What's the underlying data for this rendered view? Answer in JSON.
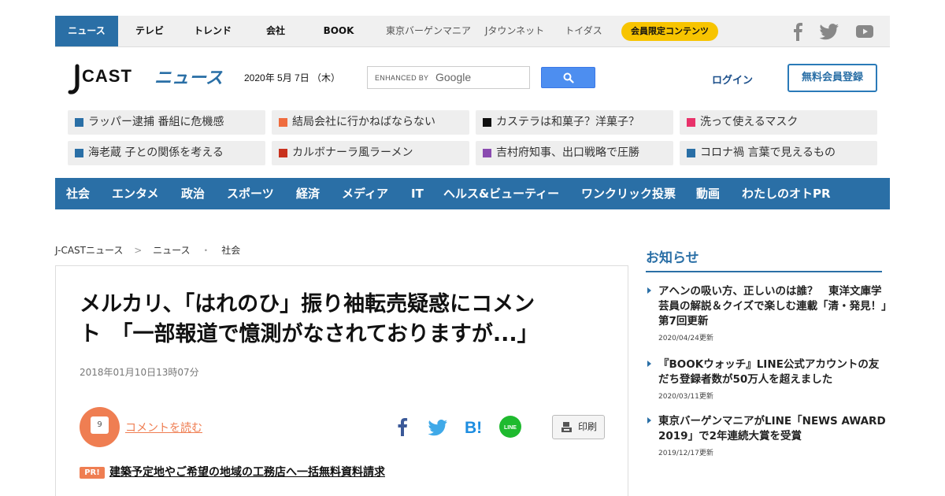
{
  "topnav": {
    "items": [
      "ニュース",
      "テレビ",
      "トレンド",
      "会社",
      "BOOK",
      "東京バーゲンマニア",
      "Jタウンネット",
      "トイダス"
    ],
    "member_badge": "会員限定コンテンツ"
  },
  "header": {
    "logo_text": "J-CAST ニュース",
    "date": "2020年 5月 7日 （木）",
    "search_enhanced": "ENHANCED BY",
    "search_google": "Google",
    "login": "ログイン",
    "register": "無料会員登録"
  },
  "tags": [
    {
      "label": "ラッパー逮捕 番組に危機感",
      "color": "#2a6fa6"
    },
    {
      "label": "結局会社に行かねばならない",
      "color": "#ef6c3e"
    },
    {
      "label": "カステラは和菓子？洋菓子？",
      "color": "#111111"
    },
    {
      "label": "洗って使えるマスク",
      "color": "#e8326a"
    },
    {
      "label": "海老蔵 子との関係を考える",
      "color": "#2a6fa6"
    },
    {
      "label": "カルボナーラ風ラーメン",
      "color": "#c8321e"
    },
    {
      "label": "吉村府知事、出口戦略で圧勝",
      "color": "#8a4bb0"
    },
    {
      "label": "コロナ禍 言葉で見えるもの",
      "color": "#2a6fa6"
    }
  ],
  "categories": [
    "社会",
    "エンタメ",
    "政治",
    "スポーツ",
    "経済",
    "メディア",
    "IT",
    "ヘルス&ビューティー",
    "ワンクリック投票",
    "動画",
    "わたしのオトPR"
  ],
  "breadcrumb": [
    "J-CASTニュース",
    ">",
    "ニュース",
    "・",
    "社会"
  ],
  "article": {
    "headline_line1": "メルカリ、「はれのひ」振り袖転売疑惑にコメン",
    "headline_line2": "ト　「一部報道で憶測がなされておりますが...」",
    "pubdate": "2018年01月10日13時07分",
    "comment_count": "9",
    "comment_link": "コメントを読む",
    "print_label": "印刷",
    "pr_badge": "PR!",
    "pr_link": "建築予定地やご希望の地域の工務店へ一括無料資料請求"
  },
  "sidebar": {
    "title": "お知らせ",
    "notices": [
      {
        "text": "アヘンの吸い方、正しいのは誰？　東洋文庫学芸員の解説＆クイズで楽しむ連載「清・発見！」第7回更新",
        "date": "2020/04/24更新"
      },
      {
        "text": "『BOOKウォッチ』LINE公式アカウントの友だち登録者数が50万人を超えました",
        "date": "2020/03/11更新"
      },
      {
        "text": "東京バーゲンマニアがLINE「NEWS AWARD 2019」で2年連続大賞を受賞",
        "date": "2019/12/17更新"
      }
    ]
  },
  "colors": {
    "brand_blue": "#2a6fa6",
    "accent_orange": "#ef7e52",
    "badge_yellow": "#f7c400"
  },
  "icons": [
    "facebook-icon",
    "twitter-icon",
    "youtube-icon",
    "search-icon",
    "comment-icon",
    "hatena-icon",
    "line-icon",
    "print-icon"
  ]
}
